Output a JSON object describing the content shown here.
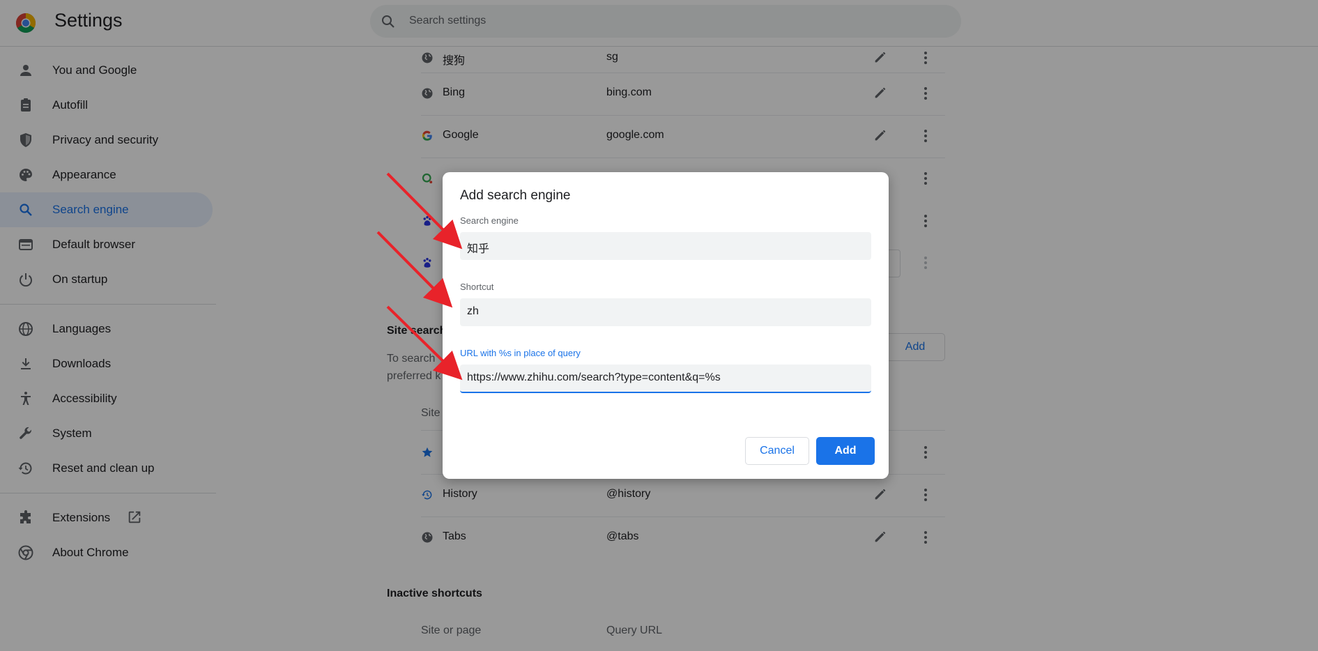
{
  "header": {
    "title": "Settings",
    "search_placeholder": "Search settings"
  },
  "sidebar": {
    "items": [
      {
        "label": "You and Google",
        "icon": "person-icon"
      },
      {
        "label": "Autofill",
        "icon": "clipboard-icon"
      },
      {
        "label": "Privacy and security",
        "icon": "shield-icon"
      },
      {
        "label": "Appearance",
        "icon": "palette-icon"
      },
      {
        "label": "Search engine",
        "icon": "search-icon",
        "active": true
      },
      {
        "label": "Default browser",
        "icon": "browser-icon"
      },
      {
        "label": "On startup",
        "icon": "power-icon"
      },
      {
        "label": "Languages",
        "icon": "globe-icon"
      },
      {
        "label": "Downloads",
        "icon": "download-icon"
      },
      {
        "label": "Accessibility",
        "icon": "accessibility-icon"
      },
      {
        "label": "System",
        "icon": "wrench-icon"
      },
      {
        "label": "Reset and clean up",
        "icon": "history-icon"
      },
      {
        "label": "Extensions",
        "icon": "puzzle-icon"
      },
      {
        "label": "About Chrome",
        "icon": "chrome-icon"
      }
    ]
  },
  "main": {
    "engines": [
      {
        "name": "搜狗",
        "keyword": "sg"
      },
      {
        "name": "Bing",
        "keyword": "bing.com"
      },
      {
        "name": "Google",
        "keyword": "google.com"
      }
    ],
    "site_search_title": "Site search",
    "site_search_desc_1": "To search",
    "site_search_desc_2": "preferred k",
    "site_header": "Site",
    "add_label": "Add",
    "site_rows": [
      {
        "name": "History",
        "keyword": "@history"
      },
      {
        "name": "Tabs",
        "keyword": "@tabs"
      }
    ],
    "inactive_title": "Inactive shortcuts",
    "inactive_col1": "Site or page",
    "inactive_col2": "Query URL"
  },
  "dialog": {
    "title": "Add search engine",
    "engine_label": "Search engine",
    "engine_value": "知乎",
    "shortcut_label": "Shortcut",
    "shortcut_value": "zh",
    "url_label": "URL with %s in place of query",
    "url_value": "https://www.zhihu.com/search?type=content&q=%s",
    "cancel": "Cancel",
    "add": "Add"
  },
  "colors": {
    "accent": "#1a73e8",
    "annotation_arrow": "#e8232a"
  }
}
